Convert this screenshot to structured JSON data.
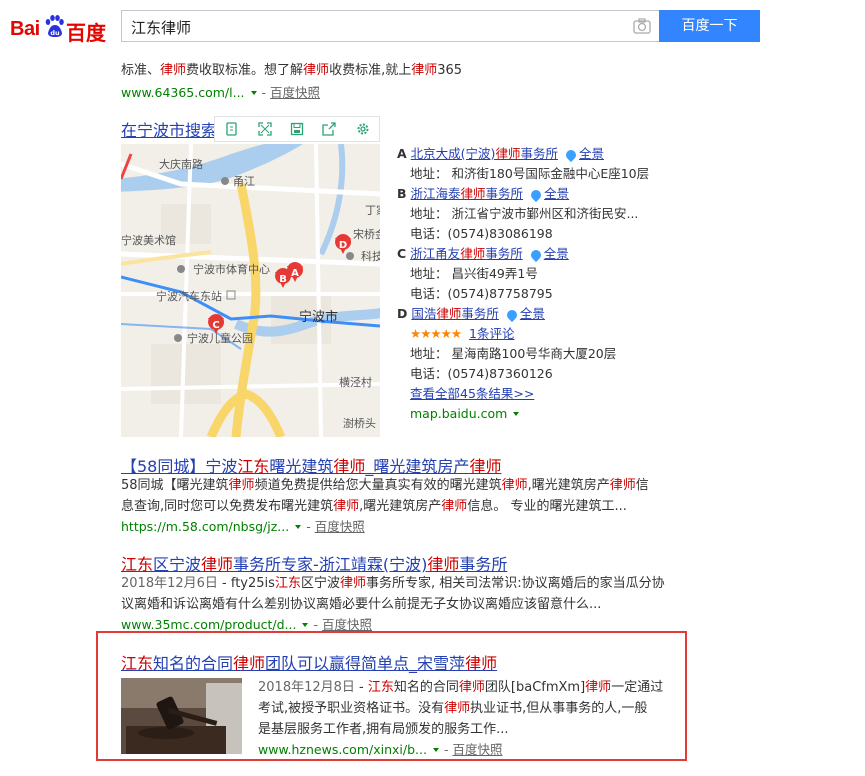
{
  "header": {
    "logo_left": "Bai",
    "logo_right": "百度",
    "logo_du": "du",
    "query": "江东律师",
    "search_button": "百度一下"
  },
  "result0": {
    "snippet_parts": [
      "标准、",
      "律师",
      "费收取标准。想了解",
      "律师",
      "收费标准,就上",
      "律师",
      "365"
    ],
    "url": "www.64365.com/l...",
    "snapshot": "百度快照"
  },
  "map_result": {
    "title": "在宁波市搜索",
    "map_labels": {
      "road1": "大庆南路",
      "place1": "甬江",
      "place2": "丁家",
      "place3": "宁波美术馆",
      "place4": "宋桥金村",
      "place5": "科技",
      "place6": "宁波市体育中心",
      "place7": "宁波汽车东站",
      "city": "宁波市",
      "place8": "宁波儿童公园",
      "place9": "横泾村",
      "place10": "澍桥头"
    },
    "pins": [
      "A",
      "B",
      "C",
      "D"
    ],
    "pois": [
      {
        "letter": "A",
        "name_parts": [
          "北京大成(宁波)",
          "律师",
          "事务所"
        ],
        "pano": "全景",
        "address": "地址：  和济街180号国际金融中心E座10层"
      },
      {
        "letter": "B",
        "name_parts": [
          "浙江海泰",
          "律师",
          "事务所"
        ],
        "pano": "全景",
        "address": "地址：  浙江省宁波市鄞州区和济街民安...",
        "phone": "电话：(0574)83086198"
      },
      {
        "letter": "C",
        "name_parts": [
          "浙江甬友",
          "律师",
          "事务所"
        ],
        "pano": "全景",
        "address": "地址：  昌兴街49弄1号",
        "phone": "电话：(0574)87758795"
      },
      {
        "letter": "D",
        "name_parts": [
          "国浩",
          "律师",
          "事务所"
        ],
        "pano": "全景",
        "stars": "★★★★★",
        "rating": 5,
        "review": "1条评论",
        "address": "地址：  星海南路100号华商大厦20层",
        "phone": "电话：(0574)87360126"
      }
    ],
    "view_all": "查看全部45条结果>>",
    "url": "map.baidu.com"
  },
  "result2": {
    "title_parts": [
      "【58同城】宁波",
      "江东",
      "曙光建筑",
      "律师",
      "_曙光建筑房产",
      "律师"
    ],
    "line1_parts": [
      "58同城【曙光建筑",
      "律师",
      "频道免费提供给您大量真实有效的曙光建筑",
      "律师",
      ",曙光建筑房产",
      "律师",
      "信"
    ],
    "line2_parts": [
      "息查询,同时您可以免费发布曙光建筑",
      "律师",
      ",曙光建筑房产",
      "律师",
      "信息。 专业的曙光建筑工..."
    ],
    "url": "https://m.58.com/nbsg/jz...",
    "snapshot": "百度快照"
  },
  "result3": {
    "title_parts": [
      "江东",
      "区宁波",
      "律师",
      "事务所专家-浙江靖霖(宁波)",
      "律师",
      "事务所"
    ],
    "date": "2018年12月6日",
    "line1_parts": [
      " - fty25is",
      "江东",
      "区宁波",
      "律师",
      "事务所专家, 相关司法常识:协议离婚后的家当瓜分协"
    ],
    "line2": "议离婚和诉讼离婚有什么差别协议离婚必要什么前提无子女协议离婚应该留意什么...",
    "url": "www.35mc.com/product/d...",
    "snapshot": "百度快照"
  },
  "result4": {
    "title_parts": [
      "江东",
      "知名的合同",
      "律师",
      "团队可以赢得简单点_宋雪萍",
      "律师"
    ],
    "date": "2018年12月8日",
    "line1_parts": [
      " - ",
      "江东",
      "知名的合同",
      "律师",
      "团队[baCfmXm]",
      "律师",
      "一定通过"
    ],
    "line2_parts": [
      "考试,被授予职业资格证书。没有",
      "律师",
      "执业证书,但从事事务的人,一般"
    ],
    "line3": "是基层服务工作者,拥有局颁发的服务工作...",
    "url": "www.hznews.com/xinxi/b...",
    "snapshot": "百度快照"
  },
  "colors": {
    "brand_red": "#e10602",
    "button_blue": "#3385ff",
    "link_blue": "#2440b3",
    "url_green": "#008000",
    "highlight_red": "#c00",
    "frame_red": "#e53935"
  }
}
